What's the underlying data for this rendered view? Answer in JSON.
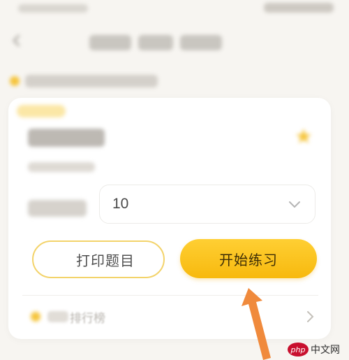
{
  "select": {
    "question_count": "10"
  },
  "buttons": {
    "print_label": "打印题目",
    "start_label": "开始练习"
  },
  "ranking": {
    "label": "排行榜"
  },
  "watermark": {
    "logo_text": "php",
    "site_text": "中文网"
  },
  "colors": {
    "accent_yellow": "#f7b90e",
    "print_border": "#f3d36a",
    "annotation_orange": "#f08a3c",
    "watermark_red": "#c8102e"
  },
  "icons": {
    "back": "chevron-left-icon",
    "star": "star-icon",
    "select_arrow": "chevron-down-icon",
    "ranking": "trophy-icon",
    "row_arrow": "chevron-right-icon",
    "annotation": "arrow-up-icon"
  }
}
